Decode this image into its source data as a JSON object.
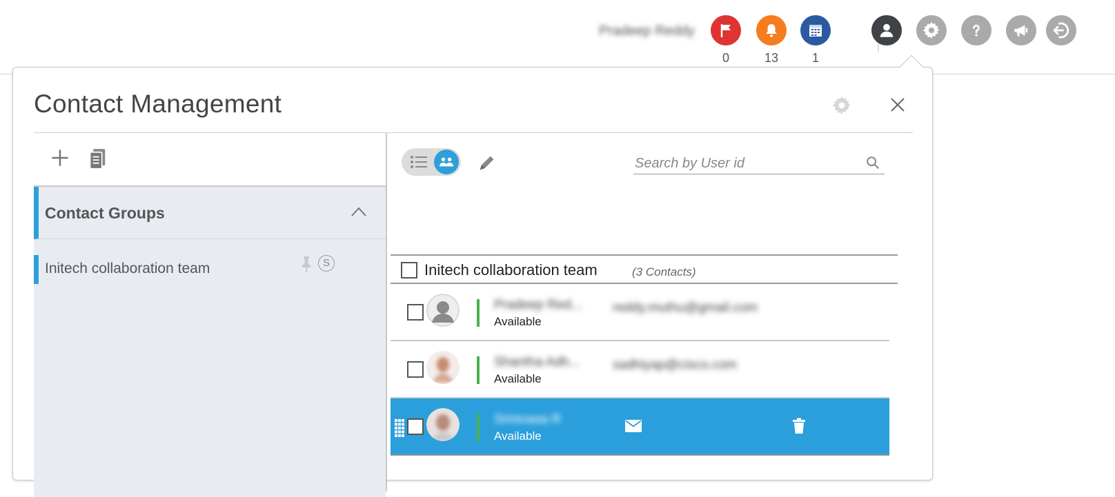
{
  "header": {
    "user_name": "Pradeep Reddy",
    "notifications": [
      {
        "name": "flag",
        "count": "0",
        "color": "#e03333"
      },
      {
        "name": "bell",
        "count": "13",
        "color": "#f57c1f"
      },
      {
        "name": "calendar",
        "count": "1",
        "color": "#2c5aa0"
      }
    ],
    "icons": [
      "user-icon",
      "gear-icon",
      "help-icon",
      "megaphone-icon",
      "logout-icon"
    ]
  },
  "panel": {
    "title": "Contact Management"
  },
  "groups_panel": {
    "header": "Contact Groups",
    "items": [
      {
        "label": "Initech collaboration team",
        "badge": "S"
      }
    ]
  },
  "contacts_panel": {
    "search_placeholder": "Search by User id",
    "group_name": "Initech collaboration team",
    "group_count": "(3 Contacts)",
    "contacts": [
      {
        "name": "Pradeep Red...",
        "email": "reddy.muthu@gmail.com",
        "status": "Available",
        "selected": false
      },
      {
        "name": "Shantha Adh...",
        "email": "sadhiyap@cisco.com",
        "status": "Available",
        "selected": false
      },
      {
        "name": "Srinivasa R",
        "email": "",
        "status": "Available",
        "selected": true
      }
    ]
  },
  "colors": {
    "accent": "#2d9fd9",
    "selected_row": "#2a9fdb",
    "status_available": "#4caf50"
  }
}
